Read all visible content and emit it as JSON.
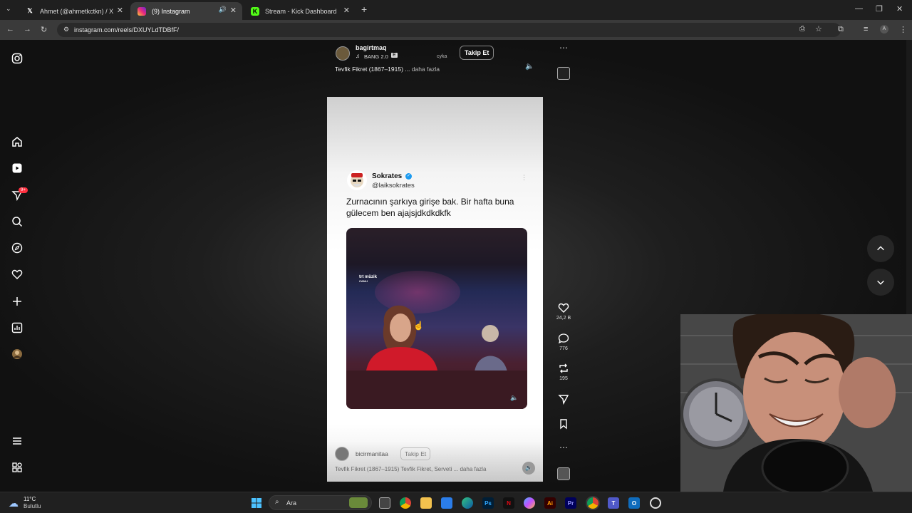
{
  "browser": {
    "tabs": [
      {
        "label": "Ahmet (@ahmetkctkn) / X",
        "icon": "x-logo-icon"
      },
      {
        "label": "(9) Instagram",
        "icon": "instagram-icon"
      },
      {
        "label": "Stream - Kick Dashboard",
        "icon": "kick-icon"
      }
    ],
    "new_tab": "+",
    "url": "instagram.com/reels/DXUYLdTDBfF/"
  },
  "reel_top": {
    "username": "bagirtmaq",
    "music": "BANG 2.0",
    "music_extra": "cyka",
    "follow": "Takip Et",
    "caption": "Tevfik Fikret (1867–1915) ...",
    "more": "daha fazla"
  },
  "tweet": {
    "name": "Sokrates",
    "handle": "@laiksokrates",
    "text": "Zurnacının şarkıya girişe bak. Bir hafta buna gülecem ben ajajsjdkdkdkfk",
    "video_channel": "trt müzik",
    "video_channel_sub": "CANLI"
  },
  "reel_bottom": {
    "username": "bicirmanitaa",
    "follow": "Takip Et",
    "caption": "Tevfik Fikret (1867–1915) Tevfik Fikret, Serveti ...",
    "more": "daha fazla"
  },
  "actions": {
    "likes": "24,2 B",
    "comments": "776",
    "reposts": "195"
  },
  "sidenav": {
    "notification_badge": "9+"
  },
  "taskbar": {
    "weather_temp": "11°C",
    "weather_desc": "Bulutlu",
    "search_placeholder": "Ara"
  }
}
